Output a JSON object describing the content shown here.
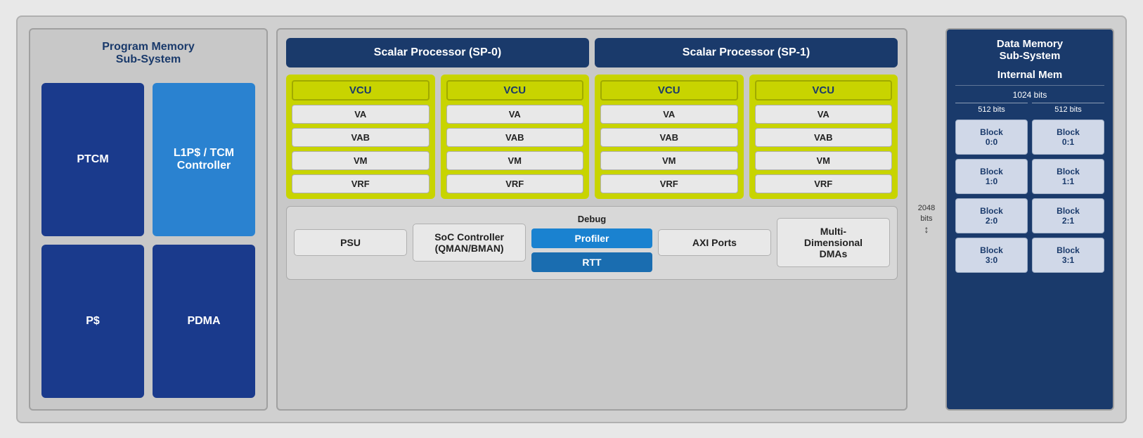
{
  "left": {
    "title": "Program Memory\nSub-System",
    "blocks": [
      {
        "id": "ptcm",
        "label": "PTCM",
        "type": "dark"
      },
      {
        "id": "l1p",
        "label": "L1P$ / TCM\nController",
        "type": "light"
      },
      {
        "id": "ps",
        "label": "P$",
        "type": "dark"
      },
      {
        "id": "pdma",
        "label": "PDMA",
        "type": "dark"
      }
    ]
  },
  "middle": {
    "sp_headers": [
      {
        "id": "sp0",
        "label": "Scalar Processor (SP-0)"
      },
      {
        "id": "sp1",
        "label": "Scalar Processor (SP-1)"
      }
    ],
    "vcu_groups": [
      {
        "id": "vcu0",
        "header": "VCU",
        "items": [
          "VA",
          "VAB",
          "VM",
          "VRF"
        ]
      },
      {
        "id": "vcu1",
        "header": "VCU",
        "items": [
          "VA",
          "VAB",
          "VM",
          "VRF"
        ]
      },
      {
        "id": "vcu2",
        "header": "VCU",
        "items": [
          "VA",
          "VAB",
          "VM",
          "VRF"
        ]
      },
      {
        "id": "vcu3",
        "header": "VCU",
        "items": [
          "VA",
          "VAB",
          "VM",
          "VRF"
        ]
      }
    ],
    "bottom_blocks": [
      {
        "id": "psu",
        "label": "PSU"
      },
      {
        "id": "soc",
        "label": "SoC Controller\n(QMAN/BMAN)"
      },
      {
        "id": "debug",
        "label": "Debug",
        "children": [
          {
            "id": "profiler",
            "label": "Profiler"
          },
          {
            "id": "rtt",
            "label": "RTT"
          }
        ]
      },
      {
        "id": "axi",
        "label": "AXI Ports"
      },
      {
        "id": "dma",
        "label": "Multi-\nDimensional\nDMAs"
      }
    ]
  },
  "right": {
    "title": "Data Memory\nSub-System",
    "internal_mem": "Internal Mem",
    "bits_1024": "1024 bits",
    "bits_512_left": "512 bits",
    "bits_512_right": "512 bits",
    "bits_2048": "2048\nbits",
    "blocks": [
      {
        "id": "b00",
        "label": "Block\n0:0"
      },
      {
        "id": "b01",
        "label": "Block\n0:1"
      },
      {
        "id": "b10",
        "label": "Block\n1:0"
      },
      {
        "id": "b11",
        "label": "Block\n1:1"
      },
      {
        "id": "b20",
        "label": "Block\n2:0"
      },
      {
        "id": "b21",
        "label": "Block\n2:1"
      },
      {
        "id": "b30",
        "label": "Block\n3:0"
      },
      {
        "id": "b31",
        "label": "Block\n3:1"
      }
    ]
  }
}
